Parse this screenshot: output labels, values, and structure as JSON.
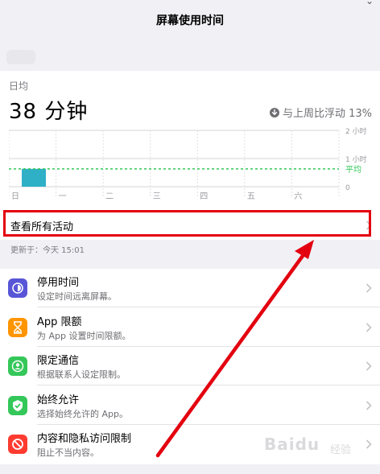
{
  "header": {
    "title": "屏幕使用时间"
  },
  "summary": {
    "label": "日均",
    "total": "38 分钟",
    "compare_text": "与上周比浮动 13%"
  },
  "chart_data": {
    "type": "bar",
    "categories": [
      "日",
      "一",
      "二",
      "三",
      "四",
      "五",
      "六"
    ],
    "values": [
      38,
      0,
      0,
      0,
      0,
      0,
      0
    ],
    "y_tick_labels": [
      "2 小时",
      "1 小时",
      "0"
    ],
    "y_ticks_minutes": [
      120,
      60,
      0
    ],
    "ylim": [
      0,
      120
    ],
    "average_label": "平均",
    "average_minutes": 38,
    "bar_color": "#30b0c7",
    "average_color": "#34c759",
    "grid": true
  },
  "activity": {
    "label": "查看所有活动",
    "updated": "更新于：今天 15:01"
  },
  "settings": [
    {
      "title": "停用时间",
      "subtitle": "设定时间远离屏幕。",
      "icon": "downtime-icon",
      "color": "#5856d6"
    },
    {
      "title": "App 限额",
      "subtitle": "为 App 设置时间限额。",
      "icon": "hourglass-icon",
      "color": "#ff9500"
    },
    {
      "title": "限定通信",
      "subtitle": "根据联系人设定限制。",
      "icon": "contact-icon",
      "color": "#34c759"
    },
    {
      "title": "始终允许",
      "subtitle": "选择始终允许的 App。",
      "icon": "checkmark-shield-icon",
      "color": "#34c759"
    },
    {
      "title": "内容和隐私访问限制",
      "subtitle": "阻止不当内容。",
      "icon": "restriction-icon",
      "color": "#ff3b30"
    }
  ],
  "watermark": {
    "text": "Baidu",
    "sub": "经验"
  }
}
